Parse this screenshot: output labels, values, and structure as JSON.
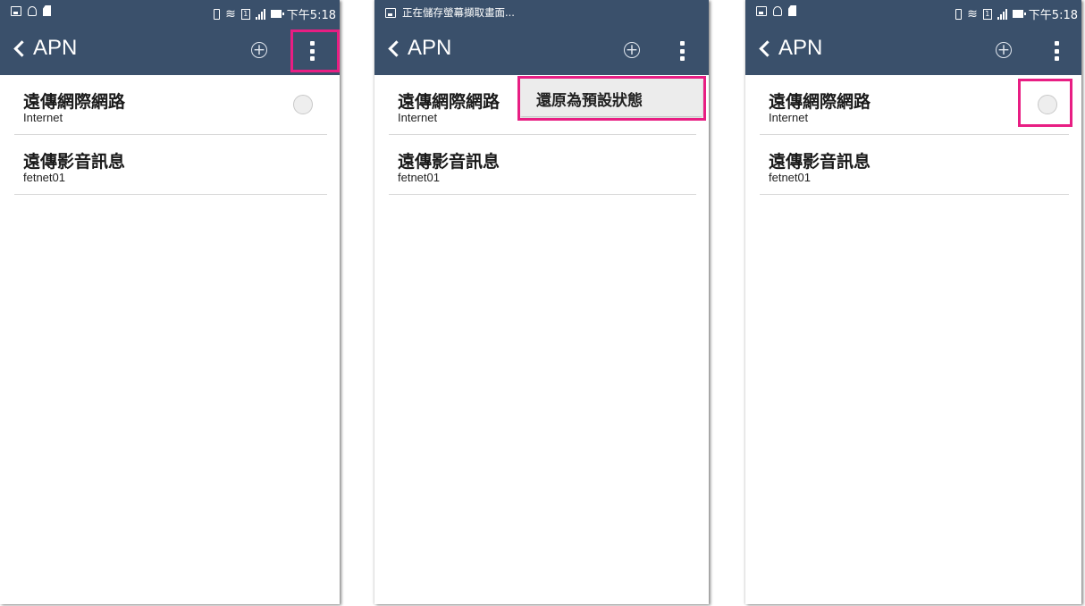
{
  "status": {
    "time": "下午5:18",
    "saving_message": "正在儲存螢幕擷取畫面..."
  },
  "app_bar": {
    "title": "APN"
  },
  "apn_list": [
    {
      "name": "遠傳網際網路",
      "apn": "Internet"
    },
    {
      "name": "遠傳影音訊息",
      "apn": "fetnet01"
    }
  ],
  "menu": {
    "reset_label": "還原為預設狀態"
  },
  "colors": {
    "app_bar": "#3a506b",
    "highlight": "#e81e83",
    "divider": "#d8d8d8"
  },
  "icons": [
    "image-icon",
    "key-icon",
    "sd-card-icon",
    "vibrate-icon",
    "wifi-icon",
    "sim-icon",
    "signal-icon",
    "battery-icon",
    "back-chevron-icon",
    "add-icon",
    "more-vert-icon"
  ]
}
